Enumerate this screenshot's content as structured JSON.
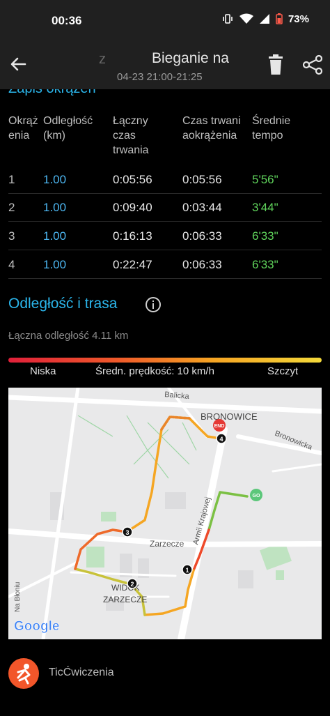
{
  "status_bar": {
    "time": "00:36",
    "battery": "73%"
  },
  "header": {
    "title_ghost": "z",
    "title": "Bieganie na",
    "subtitle": "04-23 21:00-21:25",
    "icons": [
      "back-arrow-icon",
      "trash-icon",
      "share-icon"
    ]
  },
  "laps": {
    "heading": "Zapis okrążeń",
    "columns": [
      "Okrąż enia",
      "Odległość (km)",
      "Łączny czas trwania",
      "Czas trwani aokrążenia",
      "Średnie tempo"
    ],
    "rows": [
      {
        "lap": "1",
        "km": "1.00",
        "total": "0:05:56",
        "lap_time": "0:05:56",
        "pace": "5'56\""
      },
      {
        "lap": "2",
        "km": "1.00",
        "total": "0:09:40",
        "lap_time": "0:03:44",
        "pace": "3'44\""
      },
      {
        "lap": "3",
        "km": "1.00",
        "total": "0:16:13",
        "lap_time": "0:06:33",
        "pace": "6'33\""
      },
      {
        "lap": "4",
        "km": "1.00",
        "total": "0:22:47",
        "lap_time": "0:06:33",
        "pace": "6'33\""
      }
    ]
  },
  "route": {
    "title": "Odległość i trasa",
    "total_distance": "Łączna odległość 4.11 km",
    "speed_low": "Niska",
    "speed_avg": "Średn. prędkość: 10 km/h",
    "speed_peak": "Szczyt",
    "map": {
      "labels": [
        "Balicka",
        "BRONOWICE",
        "Bronowicka",
        "Armii Krajowej",
        "Zarzecze",
        "WIDOK",
        "ZARZECZE",
        "Na Błoniu"
      ],
      "end_label": "END",
      "go_label": "GO",
      "markers": [
        "1",
        "2",
        "3",
        "4"
      ],
      "provider": "Google"
    }
  },
  "footer": {
    "app_name": "TicĆwiczenia"
  },
  "colors": {
    "accent": "#2bb5ea",
    "pace_green": "#5fd35b",
    "distance_blue": "#4db7f2",
    "logo_orange": "#f2562a"
  }
}
